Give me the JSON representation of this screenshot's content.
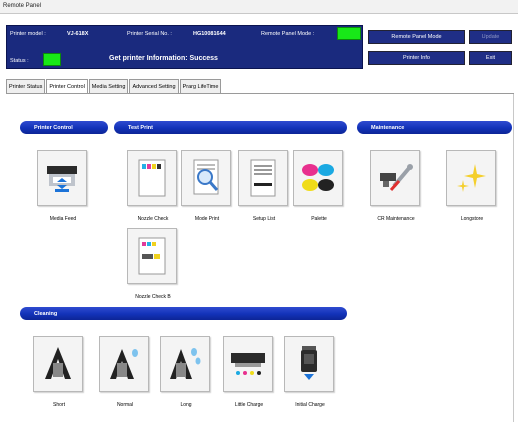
{
  "window": {
    "title": "Remote Panel"
  },
  "info_panel": {
    "printer_model_label": "Printer model :",
    "printer_model_value": "VJ-618X",
    "serial_label": "Printer Serial No. :",
    "serial_value": "HG10081644",
    "remote_mode_label": "Remote Panel Mode :",
    "status_label": "Status :",
    "status_text": "Get printer Information: Success",
    "indicator_color": "#18e818"
  },
  "buttons": {
    "remote_panel_mode": "Remote Panel Mode",
    "update": "Update",
    "printer_info": "Printer Info",
    "exit": "Exit"
  },
  "tabs": [
    {
      "label": "Printer Status",
      "active": false
    },
    {
      "label": "Printer Control",
      "active": true
    },
    {
      "label": "Media Setting",
      "active": false
    },
    {
      "label": "Advanced Setting",
      "active": false
    },
    {
      "label": "Prarg LifeTime",
      "active": false
    }
  ],
  "sections": {
    "printer_control": "Printer Control",
    "test_print": "Test Print",
    "maintenance": "Maintenance",
    "cleaning": "Cleaning"
  },
  "tools": {
    "media_feed": "Media Feed",
    "nozzle_check": "Nozzle Check",
    "mode_print": "Mode Print",
    "setup_list": "Setup List",
    "palette": "Palette",
    "cr_maintenance": "CR Maintenance",
    "longstore": "Longstore",
    "nozzle_check_b": "Nozzle Check B",
    "short": "Short",
    "normal": "Normal",
    "long": "Long",
    "little_charge": "Little Charge",
    "initial_charge": "Initial Charge"
  }
}
